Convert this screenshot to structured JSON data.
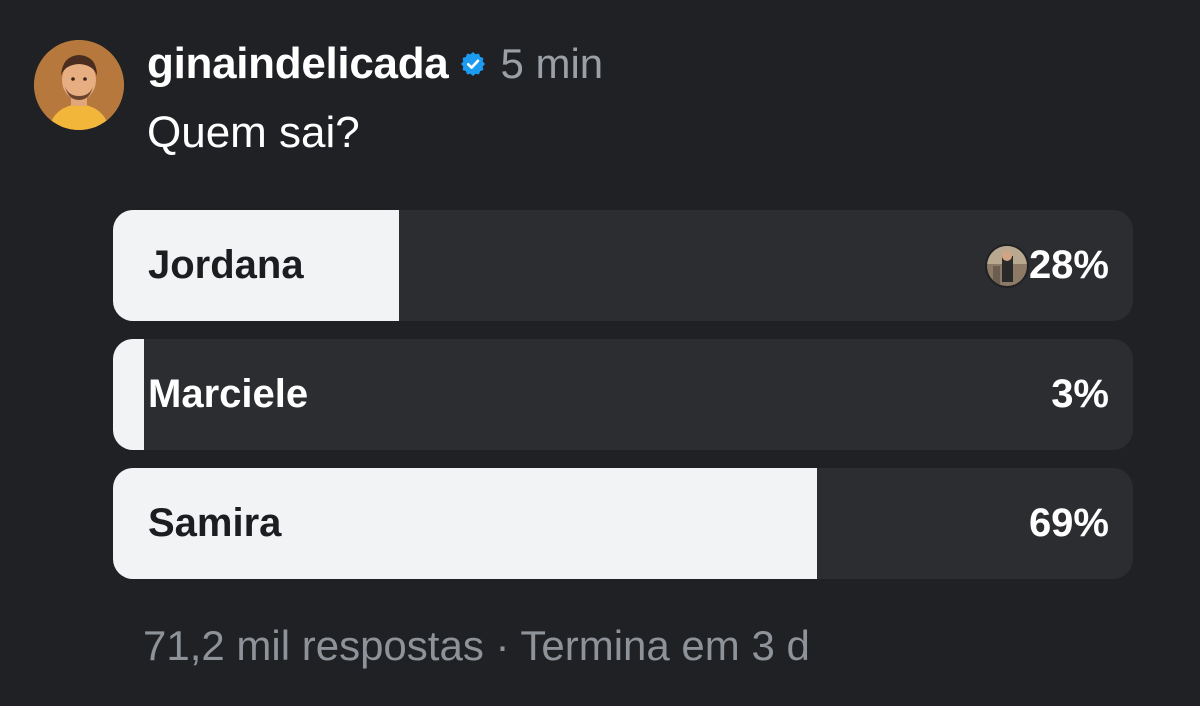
{
  "post": {
    "username": "ginaindelicada",
    "time": "5 min",
    "question": "Quem sai?"
  },
  "poll": {
    "options": [
      {
        "label": "Jordana",
        "percent_text": "28%",
        "fill_fraction": 0.28,
        "voted_by_viewer": true
      },
      {
        "label": "Marciele",
        "percent_text": "3%",
        "fill_fraction": 0.03,
        "voted_by_viewer": false
      },
      {
        "label": "Samira",
        "percent_text": "69%",
        "fill_fraction": 0.69,
        "voted_by_viewer": false
      }
    ],
    "footer": "71,2 mil respostas · Termina em 3 d"
  },
  "colors": {
    "background": "#202124",
    "bar_track": "#2c2d31",
    "bar_fill": "#f2f3f5",
    "verified": "#1d9bf0",
    "muted_text": "#8e9299"
  },
  "icons": {
    "verified": "verified-badge-icon",
    "avatar": "profile-avatar",
    "voter_avatar": "voter-avatar"
  }
}
